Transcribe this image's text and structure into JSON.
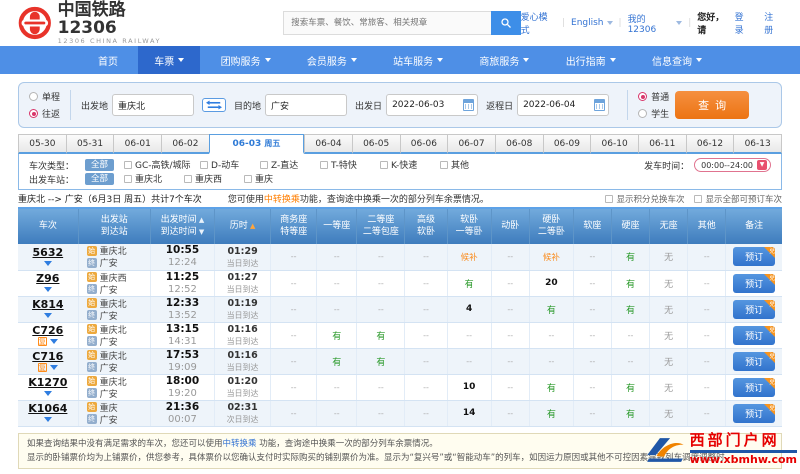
{
  "header": {
    "logo_title": "中国铁路12306",
    "logo_subtitle": "12306 CHINA RAILWAY",
    "search_placeholder": "搜索车票、餐饮、常旅客、相关规章",
    "links": {
      "care_mode": "爱心模式",
      "language": "English",
      "my12306": "我的12306",
      "greeting": "您好，请",
      "login": "登录",
      "register": "注册"
    }
  },
  "nav": {
    "items": [
      {
        "label": "首页",
        "active": false,
        "dropdown": false
      },
      {
        "label": "车票",
        "active": true,
        "dropdown": true
      },
      {
        "label": "团购服务",
        "active": false,
        "dropdown": true
      },
      {
        "label": "会员服务",
        "active": false,
        "dropdown": true
      },
      {
        "label": "站车服务",
        "active": false,
        "dropdown": true
      },
      {
        "label": "商旅服务",
        "active": false,
        "dropdown": true
      },
      {
        "label": "出行指南",
        "active": false,
        "dropdown": true
      },
      {
        "label": "信息查询",
        "active": false,
        "dropdown": true
      }
    ]
  },
  "search_form": {
    "trip_type": {
      "one_way": "单程",
      "round_trip": "往返",
      "selected": "round_trip"
    },
    "from": {
      "label": "出发地",
      "value": "重庆北"
    },
    "to": {
      "label": "目的地",
      "value": "广安"
    },
    "depart_date": {
      "label": "出发日",
      "value": "2022-06-03"
    },
    "return_date": {
      "label": "返程日",
      "value": "2022-06-04"
    },
    "passenger_type": {
      "normal": "普通",
      "student": "学生",
      "selected": "normal"
    },
    "submit_label": "查询"
  },
  "date_tabs": {
    "tabs": [
      "05-30",
      "05-31",
      "06-01",
      "06-02",
      "06-03",
      "06-04",
      "06-05",
      "06-06",
      "06-07",
      "06-08",
      "06-09",
      "06-10",
      "06-11",
      "06-12",
      "06-13"
    ],
    "active": "06-03",
    "active_weekday": "周五"
  },
  "filters": {
    "train_type": {
      "label": "车次类型：",
      "all_label": "全部",
      "options": [
        "GC-高铁/城际",
        "D-动车",
        "Z-直达",
        "T-特快",
        "K-快速",
        "其他"
      ]
    },
    "depart_station": {
      "label": "出发车站：",
      "all_label": "全部",
      "options": [
        "重庆北",
        "重庆西",
        "重庆"
      ]
    },
    "depart_time": {
      "label": "发车时间：",
      "value": "00:00--24:00"
    }
  },
  "summary": {
    "route": "重庆北 --> 广安（6月3日 周五）共计7个车次",
    "tip_prefix": "您可使用",
    "tip_link": "中转换乘",
    "tip_suffix": "功能，查询途中换乘一次的部分列车余票情况。",
    "checkbox_points": "显示积分兑换车次",
    "checkbox_all": "显示全部可预订车次"
  },
  "table": {
    "badges": {
      "depart": "始",
      "arrive": "终"
    },
    "fuxing_label": "复",
    "book_label": "预订",
    "book_corner": "兑",
    "columns": [
      {
        "lines": [
          {
            "t": "车次"
          }
        ]
      },
      {
        "lines": [
          {
            "t": "出发站"
          },
          {
            "t": "到达站"
          }
        ]
      },
      {
        "lines": [
          {
            "t": "出发时间",
            "arrow": "up"
          },
          {
            "t": "到达时间",
            "arrow": "down"
          }
        ]
      },
      {
        "lines": [
          {
            "t": "历时",
            "arrow": "up_active"
          }
        ]
      },
      {
        "lines": [
          {
            "t": "商务座"
          },
          {
            "t": "特等座"
          }
        ]
      },
      {
        "lines": [
          {
            "t": "一等座"
          }
        ]
      },
      {
        "lines": [
          {
            "t": "二等座"
          },
          {
            "t": "二等包座"
          }
        ]
      },
      {
        "lines": [
          {
            "t": "高级"
          },
          {
            "t": "软卧"
          }
        ]
      },
      {
        "lines": [
          {
            "t": "软卧"
          },
          {
            "t": "一等卧"
          }
        ]
      },
      {
        "lines": [
          {
            "t": "动卧"
          }
        ]
      },
      {
        "lines": [
          {
            "t": "硬卧"
          },
          {
            "t": "二等卧"
          }
        ]
      },
      {
        "lines": [
          {
            "t": "软座"
          }
        ]
      },
      {
        "lines": [
          {
            "t": "硬座"
          }
        ]
      },
      {
        "lines": [
          {
            "t": "无座"
          }
        ]
      },
      {
        "lines": [
          {
            "t": "其他"
          }
        ]
      },
      {
        "lines": [
          {
            "t": "备注"
          }
        ]
      }
    ],
    "rows": [
      {
        "train_no": "5632",
        "fuxing": false,
        "from": "重庆北",
        "to": "广安",
        "dep": "10:55",
        "arr": "12:24",
        "dur": "01:29",
        "day": "当日到达",
        "seats": [
          "--",
          "--",
          "--",
          "--",
          "候补",
          "--",
          "候补",
          "--",
          "有",
          "无",
          "--"
        ]
      },
      {
        "train_no": "Z96",
        "fuxing": false,
        "from": "重庆西",
        "to": "广安",
        "dep": "11:25",
        "arr": "12:52",
        "dur": "01:27",
        "day": "当日到达",
        "seats": [
          "--",
          "--",
          "--",
          "--",
          "有",
          "--",
          "20",
          "--",
          "有",
          "无",
          "--"
        ]
      },
      {
        "train_no": "K814",
        "fuxing": false,
        "from": "重庆北",
        "to": "广安",
        "dep": "12:33",
        "arr": "13:52",
        "dur": "01:19",
        "day": "当日到达",
        "seats": [
          "--",
          "--",
          "--",
          "--",
          "4",
          "--",
          "有",
          "--",
          "有",
          "无",
          "--"
        ]
      },
      {
        "train_no": "C726",
        "fuxing": true,
        "from": "重庆北",
        "to": "广安",
        "dep": "13:15",
        "arr": "14:31",
        "dur": "01:16",
        "day": "当日到达",
        "seats": [
          "--",
          "有",
          "有",
          "--",
          "--",
          "--",
          "--",
          "--",
          "--",
          "无",
          "--"
        ]
      },
      {
        "train_no": "C716",
        "fuxing": true,
        "from": "重庆北",
        "to": "广安",
        "dep": "17:53",
        "arr": "19:09",
        "dur": "01:16",
        "day": "当日到达",
        "seats": [
          "--",
          "有",
          "有",
          "--",
          "--",
          "--",
          "--",
          "--",
          "--",
          "无",
          "--"
        ]
      },
      {
        "train_no": "K1270",
        "fuxing": false,
        "from": "重庆北",
        "to": "广安",
        "dep": "18:00",
        "arr": "19:20",
        "dur": "01:20",
        "day": "当日到达",
        "seats": [
          "--",
          "--",
          "--",
          "--",
          "10",
          "--",
          "有",
          "--",
          "有",
          "无",
          "--"
        ]
      },
      {
        "train_no": "K1064",
        "fuxing": false,
        "from": "重庆",
        "to": "广安",
        "dep": "21:36",
        "arr": "00:07",
        "dur": "02:31",
        "day": "次日到达",
        "seats": [
          "--",
          "--",
          "--",
          "--",
          "14",
          "--",
          "有",
          "--",
          "有",
          "无",
          "--"
        ]
      }
    ]
  },
  "notice": {
    "line1_prefix": "如果查询结果中没有满足需求的车次，您还可以使用",
    "line1_link": "中转换乘",
    "line1_suffix": " 功能，查询途中换乘一次的部分列车余票情况。",
    "line2": "显示的卧铺票价均为上铺票价，供您参考，具体票价以您确认支付时实际购买的铺别票价为准。显示为“复兴号”或“智能动车”的列车，如因运力原因或其他不可控因素导致列车调度调整时，"
  },
  "watermark": {
    "site_name": "西部门户网",
    "site_url": "www.xbmhw.com"
  }
}
